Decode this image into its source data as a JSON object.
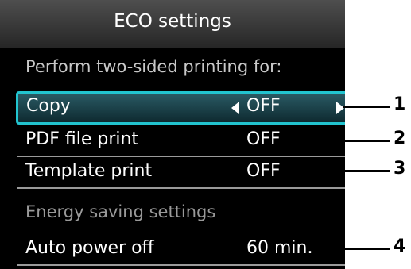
{
  "screen": {
    "title": "ECO settings",
    "section_two_sided": "Perform two-sided printing for:",
    "section_energy": "Energy saving settings"
  },
  "rows": [
    {
      "label": "Copy",
      "value": "OFF",
      "selected": true
    },
    {
      "label": "PDF file print",
      "value": "OFF"
    },
    {
      "label": "Template print",
      "value": "OFF"
    },
    {
      "label": "Auto power off",
      "value": "60 min."
    }
  ],
  "callouts": [
    "1",
    "2",
    "3",
    "4"
  ],
  "colors": {
    "selection_border": "#22c4cf",
    "screen_background": "#000000",
    "text": "#ffffff"
  }
}
